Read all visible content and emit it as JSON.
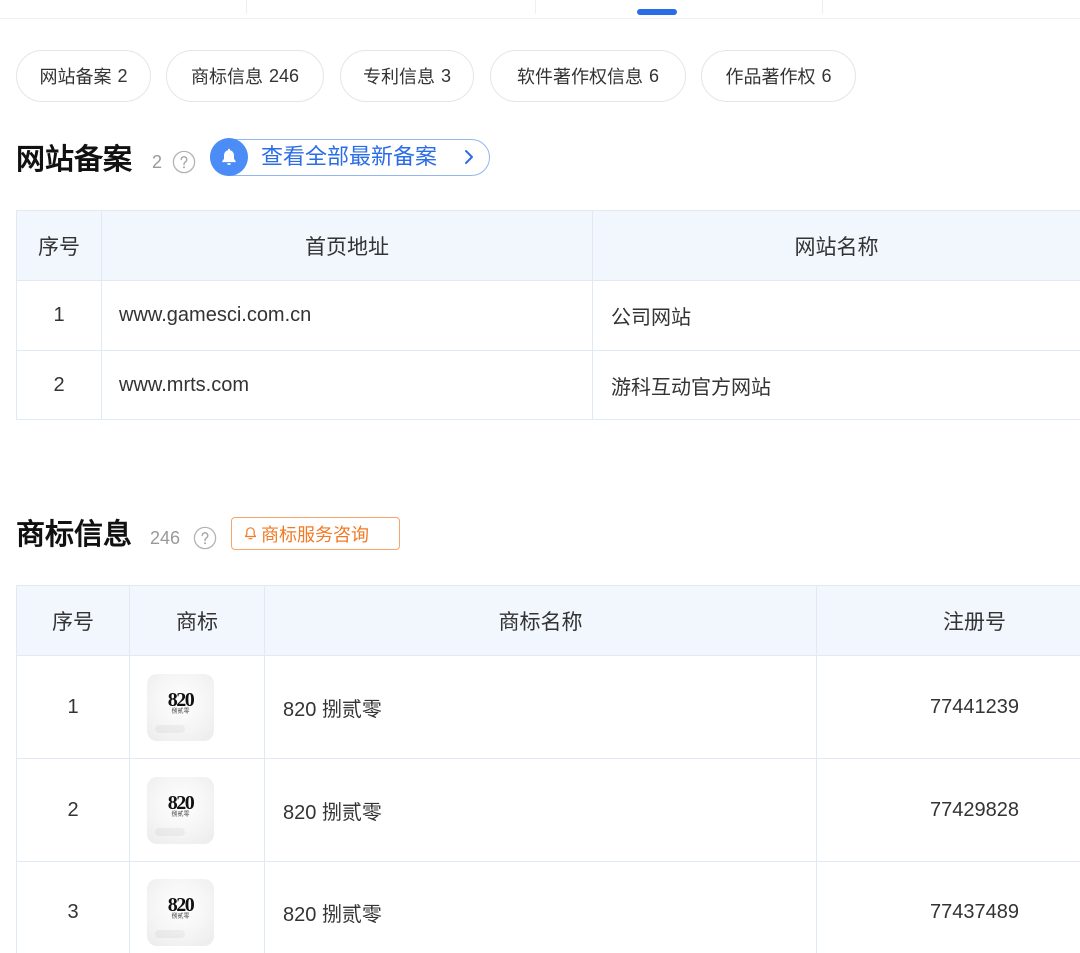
{
  "colors": {
    "primary_blue": "#2b6de6",
    "bell_blue": "#4b8cf6",
    "pill_border_blue": "#93b6f0",
    "accent_orange": "#f07a26",
    "orange_border": "#f5a56e",
    "table_header_bg": "#f2f7fe",
    "table_border": "#e1e9f4",
    "chip_border": "#e5e5e5",
    "text": "#333333",
    "muted": "#999999"
  },
  "filter_chips": [
    {
      "label": "网站备案",
      "count": "2"
    },
    {
      "label": "商标信息",
      "count": "246"
    },
    {
      "label": "专利信息",
      "count": "3"
    },
    {
      "label": "软件著作权信息",
      "count": "6"
    },
    {
      "label": "作品著作权",
      "count": "6"
    }
  ],
  "website_filing": {
    "title": "网站备案",
    "count": "2",
    "help_icon": "question-circle-icon",
    "view_all": {
      "label": "查看全部最新备案",
      "icon": "bell-icon",
      "trailing_icon": "chevron-right-icon"
    },
    "table": {
      "headers": {
        "index": "序号",
        "homepage": "首页地址",
        "site_name": "网站名称"
      },
      "rows": [
        {
          "index": "1",
          "homepage": "www.gamesci.com.cn",
          "site_name": "公司网站"
        },
        {
          "index": "2",
          "homepage": "www.mrts.com",
          "site_name": "游科互动官方网站"
        }
      ]
    }
  },
  "trademark": {
    "title": "商标信息",
    "count": "246",
    "help_icon": "question-circle-icon",
    "consult": {
      "label": "商标服务咨询",
      "icon": "bell-outline-icon"
    },
    "table": {
      "headers": {
        "index": "序号",
        "logo": "商标",
        "name": "商标名称",
        "reg_no": "注册号"
      },
      "rows": [
        {
          "index": "1",
          "logo_text": "820",
          "logo_subtext": "捌贰零",
          "name": "820 捌贰零",
          "reg_no": "77441239"
        },
        {
          "index": "2",
          "logo_text": "820",
          "logo_subtext": "捌贰零",
          "name": "820 捌贰零",
          "reg_no": "77429828"
        },
        {
          "index": "3",
          "logo_text": "820",
          "logo_subtext": "捌贰零",
          "name": "820 捌贰零",
          "reg_no": "77437489"
        }
      ]
    }
  }
}
